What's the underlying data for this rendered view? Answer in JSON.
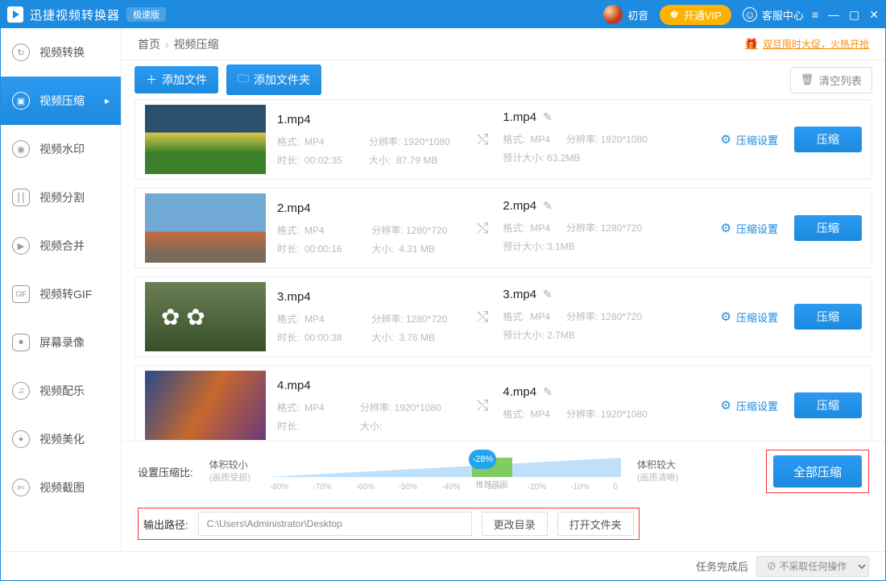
{
  "titlebar": {
    "app_name": "迅捷视频转换器",
    "edition_badge": "极速版",
    "user_name": "初音",
    "vip_label": "开通VIP",
    "support_label": "客服中心"
  },
  "sidebar": {
    "items": [
      {
        "label": "视频转换",
        "icon": "↻"
      },
      {
        "label": "视频压缩",
        "icon": "▣"
      },
      {
        "label": "视频水印",
        "icon": "◉"
      },
      {
        "label": "视频分割",
        "icon": "⎮⎮"
      },
      {
        "label": "视频合并",
        "icon": "▶"
      },
      {
        "label": "视频转GIF",
        "icon": "GIF"
      },
      {
        "label": "屏幕录像",
        "icon": "⏺"
      },
      {
        "label": "视频配乐",
        "icon": "♫"
      },
      {
        "label": "视频美化",
        "icon": "✦"
      },
      {
        "label": "视频截图",
        "icon": "✄"
      }
    ],
    "active_index": 1
  },
  "crumbs": {
    "home": "首页",
    "current": "视频压缩",
    "promo": "双旦限时大促，火热开抢"
  },
  "toolbar": {
    "add_file": "添加文件",
    "add_folder": "添加文件夹",
    "clear": "清空列表"
  },
  "labels": {
    "format": "格式:",
    "resolution": "分辨率:",
    "duration": "时长:",
    "size": "大小:",
    "est_size": "预计大小:",
    "compress_settings": "压缩设置",
    "compress": "压缩",
    "ratio_label": "设置压缩比:",
    "ratio_small": "体积较小",
    "ratio_small_sub": "(画质受损)",
    "ratio_large": "体积较大",
    "ratio_large_sub": "(画质清晰)",
    "rec_range": "推荐范围",
    "all_compress": "全部压缩",
    "output_path": "输出路径:",
    "change_dir": "更改目录",
    "open_folder": "打开文件夹",
    "after_task": "任务完成后"
  },
  "slider": {
    "percent": "-28%",
    "ticks": [
      "-80%",
      "-70%",
      "-60%",
      "-50%",
      "-40%",
      "-30%",
      "-20%",
      "-10%",
      "0"
    ]
  },
  "output": {
    "path": "C:\\Users\\Administrator\\Desktop"
  },
  "status": {
    "after_task_value": "不采取任何操作"
  },
  "files": [
    {
      "name": "1.mp4",
      "format": "MP4",
      "resolution": "1920*1080",
      "duration": "00:02:35",
      "size": "87.79 MB",
      "out_name": "1.mp4",
      "out_format": "MP4",
      "out_resolution": "1920*1080",
      "est_size": "63.2MB",
      "thumb": "t1"
    },
    {
      "name": "2.mp4",
      "format": "MP4",
      "resolution": "1280*720",
      "duration": "00:00:16",
      "size": "4.31 MB",
      "out_name": "2.mp4",
      "out_format": "MP4",
      "out_resolution": "1280*720",
      "est_size": "3.1MB",
      "thumb": "t2"
    },
    {
      "name": "3.mp4",
      "format": "MP4",
      "resolution": "1280*720",
      "duration": "00:00:38",
      "size": "3.76 MB",
      "out_name": "3.mp4",
      "out_format": "MP4",
      "out_resolution": "1280*720",
      "est_size": "2.7MB",
      "thumb": "t3"
    },
    {
      "name": "4.mp4",
      "format": "MP4",
      "resolution": "1920*1080",
      "duration": "",
      "size": "",
      "out_name": "4.mp4",
      "out_format": "MP4",
      "out_resolution": "1920*1080",
      "est_size": "",
      "thumb": "t4"
    }
  ]
}
